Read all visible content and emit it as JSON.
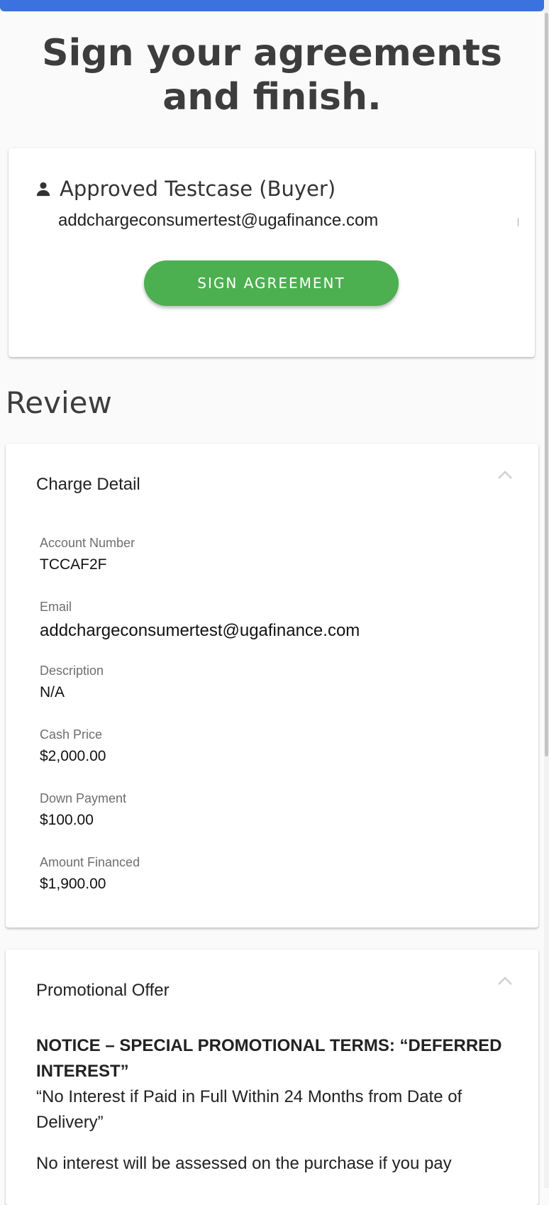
{
  "header": {
    "title": "Sign your agreements and finish."
  },
  "signer": {
    "name": "Approved Testcase (Buyer)",
    "email": "addchargeconsumertest@ugafinance.com",
    "button_label": "SIGN AGREEMENT",
    "icon": "person-icon"
  },
  "review": {
    "heading": "Review"
  },
  "charge_detail": {
    "title": "Charge Detail",
    "fields": [
      {
        "label": "Account Number",
        "value": "TCCAF2F"
      },
      {
        "label": "Email",
        "value": "addchargeconsumertest@ugafinance.com"
      },
      {
        "label": "Description",
        "value": "N/A"
      },
      {
        "label": "Cash Price",
        "value": "$2,000.00"
      },
      {
        "label": "Down Payment",
        "value": "$100.00"
      },
      {
        "label": "Amount Financed",
        "value": "$1,900.00"
      }
    ]
  },
  "promo": {
    "title": "Promotional Offer",
    "notice": "NOTICE – SPECIAL PROMOTIONAL TERMS: “DEFERRED INTEREST”",
    "quote": "“No Interest if Paid in Full Within 24 Months from Date of Delivery”",
    "body": "No interest will be assessed on the purchase if you pay"
  },
  "colors": {
    "accent": "#3a73e0",
    "button": "#4caf50"
  }
}
